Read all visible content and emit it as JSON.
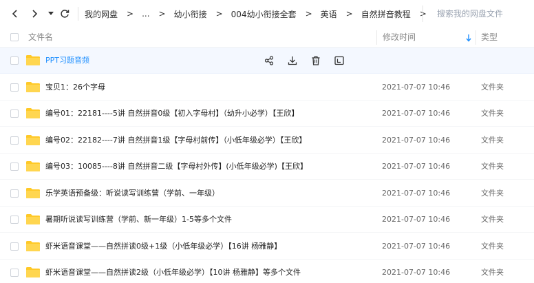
{
  "toolbar": {
    "breadcrumbs": [
      "我的网盘",
      "...",
      "幼小衔接",
      "004幼小衔接全套",
      "英语",
      "自然拼音教程"
    ],
    "separator": ">",
    "search_placeholder": "搜索我的网盘文件"
  },
  "header": {
    "name": "文件名",
    "modified": "修改时间",
    "type": "类型"
  },
  "colors": {
    "accent": "#1e8fff",
    "folder": "#ffc928",
    "selected_row_bg": "#f4f8ff"
  },
  "files": [
    {
      "name": "PPT习题音频",
      "date": "",
      "type": "",
      "selected": true
    },
    {
      "name": "宝贝1：26个字母",
      "date": "2021-07-07 10:46",
      "type": "文件夹"
    },
    {
      "name": "编号01：22181----5讲 自然拼音0级【初入字母村】（幼升小必学）【王欣】",
      "date": "2021-07-07 10:46",
      "type": "文件夹"
    },
    {
      "name": "编号02：22182----7讲 自然拼音1级【字母村前传】（小低年级必学）【王欣】",
      "date": "2021-07-07 10:46",
      "type": "文件夹"
    },
    {
      "name": "编号03：10085----8讲 自然拼音二级【字母村外传】(小低年级必学)【王欣】",
      "date": "2021-07-07 10:46",
      "type": "文件夹"
    },
    {
      "name": "乐学英语预备级：听说读写训练营（学前、一年级）",
      "date": "2021-07-07 10:46",
      "type": "文件夹"
    },
    {
      "name": "暑期听说读写训练营（学前、新一年级）1-5等多个文件",
      "date": "2021-07-07 10:46",
      "type": "文件夹"
    },
    {
      "name": "虾米语音课堂——自然拼读0级+1级（小低年级必学）【16讲 杨雅静】",
      "date": "2021-07-07 10:46",
      "type": "文件夹"
    },
    {
      "name": "虾米语音课堂——自然拼读2级（小低年级必学）【10讲 杨雅静】等多个文件",
      "date": "2021-07-07 10:46",
      "type": "文件夹"
    }
  ],
  "row_actions": [
    "share-icon",
    "download-icon",
    "delete-icon",
    "more-icon"
  ]
}
